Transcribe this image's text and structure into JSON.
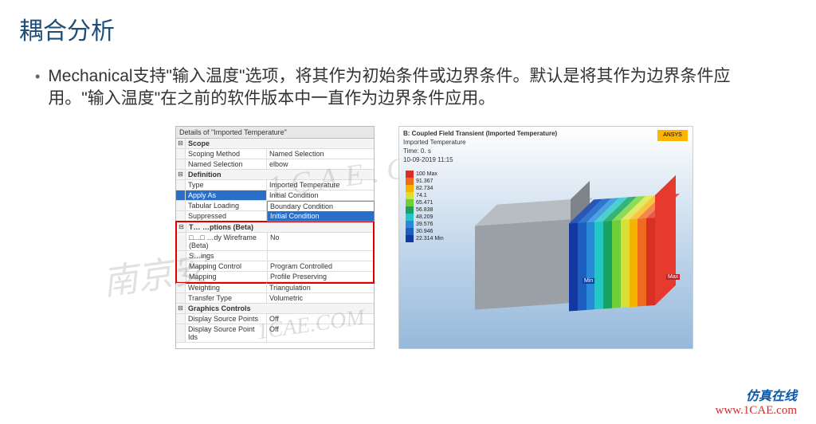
{
  "title": "耦合分析",
  "bullet": "Mechanical支持\"输入温度\"选项，将其作为初始条件或边界条件。默认是将其作为边界条件应用。\"输入温度\"在之前的软件版本中一直作为边界条件应用。",
  "watermark1": "1CAE.COM",
  "watermark2": "南京安",
  "watermark3": "1CAE.COM",
  "details": {
    "panel_title": "Details of \"Imported Temperature\"",
    "cat_scope": "Scope",
    "scoping_method": {
      "n": "Scoping Method",
      "v": "Named Selection"
    },
    "named_selection": {
      "n": "Named Selection",
      "v": "elbow"
    },
    "cat_definition": "Definition",
    "type": {
      "n": "Type",
      "v": "Imported Temperature"
    },
    "apply_as": {
      "n": "Apply As",
      "v": "Initial Condition"
    },
    "dd_boundary": "Boundary Condition",
    "dd_initial": "Initial Condition",
    "tabular": {
      "n": "Tabular Loading",
      "v": ""
    },
    "suppressed": {
      "n": "Suppressed",
      "v": ""
    },
    "cat_options": "T… …ptions (Beta)",
    "wireframe": {
      "n": "□…□ …dy Wireframe (Beta)",
      "v": "No"
    },
    "settings": {
      "n": "S…ings",
      "v": ""
    },
    "mapping_control": {
      "n": "Mapping Control",
      "v": "Program Controlled"
    },
    "mapping": {
      "n": "Mapping",
      "v": "Profile Preserving"
    },
    "weighting": {
      "n": "Weighting",
      "v": "Triangulation"
    },
    "transfer": {
      "n": "Transfer Type",
      "v": "Volumetric"
    },
    "cat_graphics": "Graphics Controls",
    "dsp": {
      "n": "Display Source Points",
      "v": "Off"
    },
    "dspi": {
      "n": "Display Source Point Ids",
      "v": "Off"
    }
  },
  "viz": {
    "header_l1": "B: Coupled Field Transient (Imported Temperature)",
    "header_l2": "Imported Temperature",
    "header_l3": "Time: 0. s",
    "header_l4": "10-09-2019 11:15",
    "legend": [
      {
        "c": "#d93025",
        "t": "100 Max"
      },
      {
        "c": "#f06a1f",
        "t": "91.367"
      },
      {
        "c": "#f5b400",
        "t": "82.734"
      },
      {
        "c": "#d8e038",
        "t": "74.1"
      },
      {
        "c": "#6fcf3b",
        "t": "65.471"
      },
      {
        "c": "#1aa260",
        "t": "56.838"
      },
      {
        "c": "#24c6c6",
        "t": "48.209"
      },
      {
        "c": "#2a88d8",
        "t": "39.576"
      },
      {
        "c": "#1d5fbf",
        "t": "30.946"
      },
      {
        "c": "#1438a0",
        "t": "22.314 Min"
      }
    ],
    "rainbow_front": [
      "#1438a0",
      "#1d5fbf",
      "#2a88d8",
      "#24c6c6",
      "#1aa260",
      "#6fcf3b",
      "#d8e038",
      "#f5b400",
      "#f06a1f",
      "#d93025"
    ],
    "rainbow_top": [
      "#2a56b8",
      "#2f76cf",
      "#49a0e4",
      "#4bd0d0",
      "#33b475",
      "#8adb5a",
      "#e3e960",
      "#f8c540",
      "#f58848",
      "#e65a4c"
    ],
    "min": "Min",
    "max": "Max",
    "logo": "ANSYS"
  },
  "footer": {
    "cn": "仿真在线",
    "url": "www.1CAE.com"
  }
}
